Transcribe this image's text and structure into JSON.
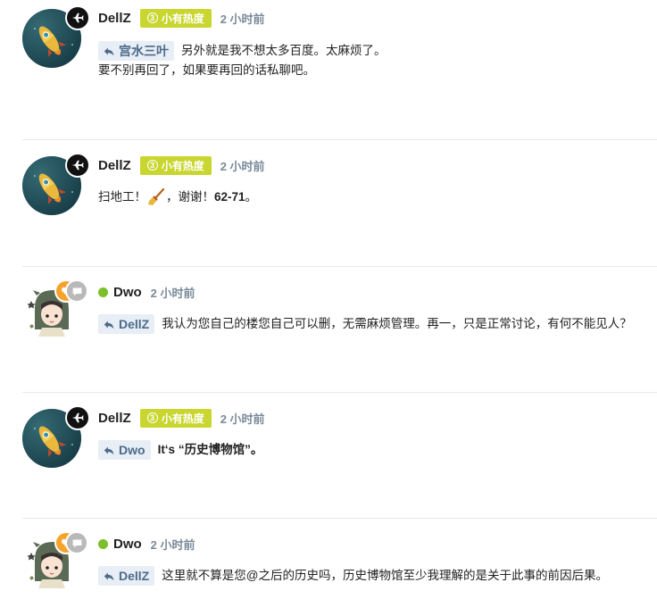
{
  "colors": {
    "heat_badge": "#c8d62f",
    "online_dot": "#7bbf2a",
    "reply_chip_bg": "#e8eef5",
    "reply_chip_text": "#4c6a8b",
    "time_text": "#7a8a9a"
  },
  "posts": [
    {
      "username": "DellZ",
      "heat_label": "小有热度",
      "heat_level": "3",
      "time": "2 小时前",
      "avatar_icon": "rocket-avatar-icon",
      "badge_icon": "airplane-badge-icon",
      "reply_to": "宫水三叶",
      "text_line1": "另外就是我不想太多百度。太麻烦了。",
      "text_line2": "要不别再回了，如果要再回的话私聊吧。"
    },
    {
      "username": "DellZ",
      "heat_label": "小有热度",
      "heat_level": "3",
      "time": "2 小时前",
      "avatar_icon": "rocket-avatar-icon",
      "badge_icon": "airplane-badge-icon",
      "text_before": "扫地工！",
      "emoji_icon": "broom-icon",
      "text_mid": "，谢谢！",
      "text_bold": "62-71",
      "text_after": "。"
    },
    {
      "username": "Dwo",
      "time": "2 小时前",
      "online": true,
      "avatar_icon": "anime-girl-avatar-icon",
      "reply_to": "DellZ",
      "text": "我认为您自己的楼您自己可以删，无需麻烦管理。再一，只是正常讨论，有何不能见人？"
    },
    {
      "username": "DellZ",
      "heat_label": "小有热度",
      "heat_level": "3",
      "time": "2 小时前",
      "avatar_icon": "rocket-avatar-icon",
      "badge_icon": "airplane-badge-icon",
      "reply_to": "Dwo",
      "text": "It‘s “历史博物馆”。"
    },
    {
      "username": "Dwo",
      "time": "2 小时前",
      "online": true,
      "avatar_icon": "anime-girl-avatar-icon",
      "reply_to": "DellZ",
      "text": "这里就不算是您@之后的历史吗，历史博物馆至少我理解的是关于此事的前因后果。"
    }
  ]
}
